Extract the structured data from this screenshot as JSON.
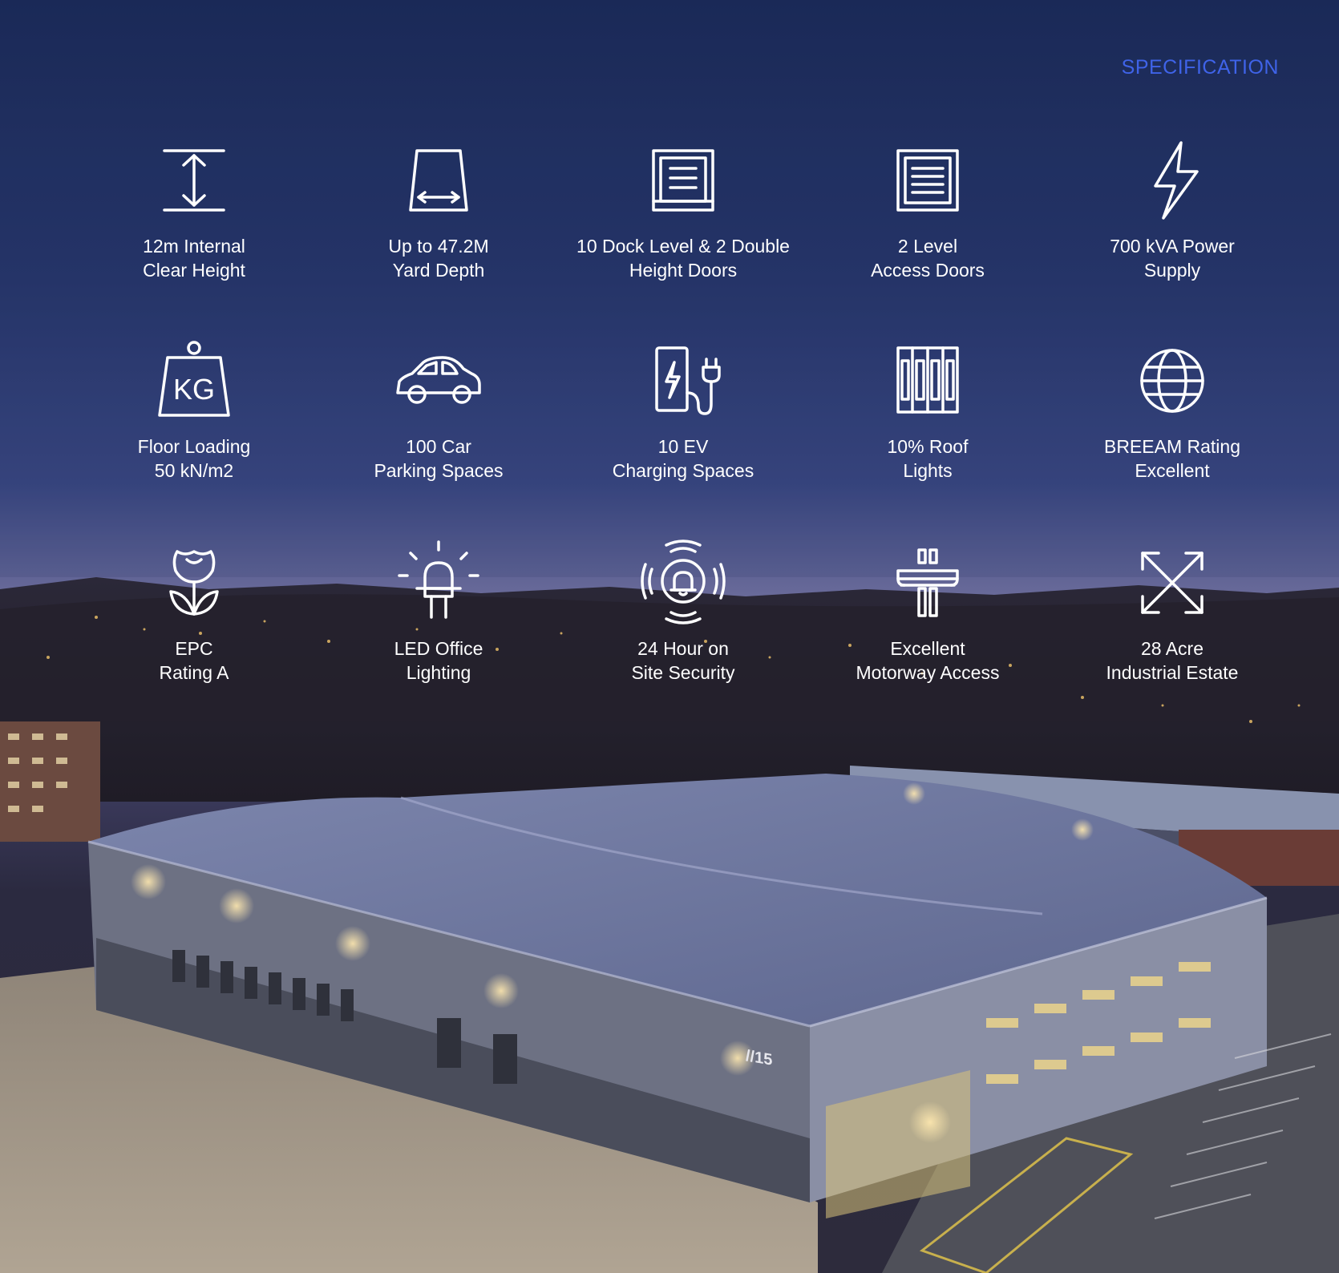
{
  "header": {
    "title": "SPECIFICATION"
  },
  "features": [
    {
      "icon": "clear-height-icon",
      "line1": "12m Internal",
      "line2": "Clear Height"
    },
    {
      "icon": "yard-depth-icon",
      "line1": "Up to 47.2M",
      "line2": "Yard Depth"
    },
    {
      "icon": "dock-door-icon",
      "line1": "10 Dock Level & 2 Double",
      "line2": "Height Doors"
    },
    {
      "icon": "level-access-door-icon",
      "line1": "2 Level",
      "line2": "Access Doors"
    },
    {
      "icon": "lightning-icon",
      "line1": "700 kVA Power",
      "line2": "Supply"
    },
    {
      "icon": "kg-weight-icon",
      "line1": "Floor Loading",
      "line2": "50 kN/m2"
    },
    {
      "icon": "car-icon",
      "line1": "100 Car",
      "line2": "Parking Spaces"
    },
    {
      "icon": "ev-charger-icon",
      "line1": "10 EV",
      "line2": "Charging Spaces"
    },
    {
      "icon": "roof-lights-icon",
      "line1": "10% Roof",
      "line2": "Lights"
    },
    {
      "icon": "globe-icon",
      "line1": "BREEAM Rating",
      "line2": "Excellent"
    },
    {
      "icon": "flower-icon",
      "line1": "EPC",
      "line2": "Rating A"
    },
    {
      "icon": "led-bulb-icon",
      "line1": "LED Office",
      "line2": "Lighting"
    },
    {
      "icon": "alarm-bell-icon",
      "line1": "24 Hour on",
      "line2": "Site Security"
    },
    {
      "icon": "motorway-icon",
      "line1": "Excellent",
      "line2": "Motorway Access"
    },
    {
      "icon": "expand-arrows-icon",
      "line1": "28 Acre",
      "line2": "Industrial Estate"
    }
  ],
  "building": {
    "unit_number": "//15"
  }
}
